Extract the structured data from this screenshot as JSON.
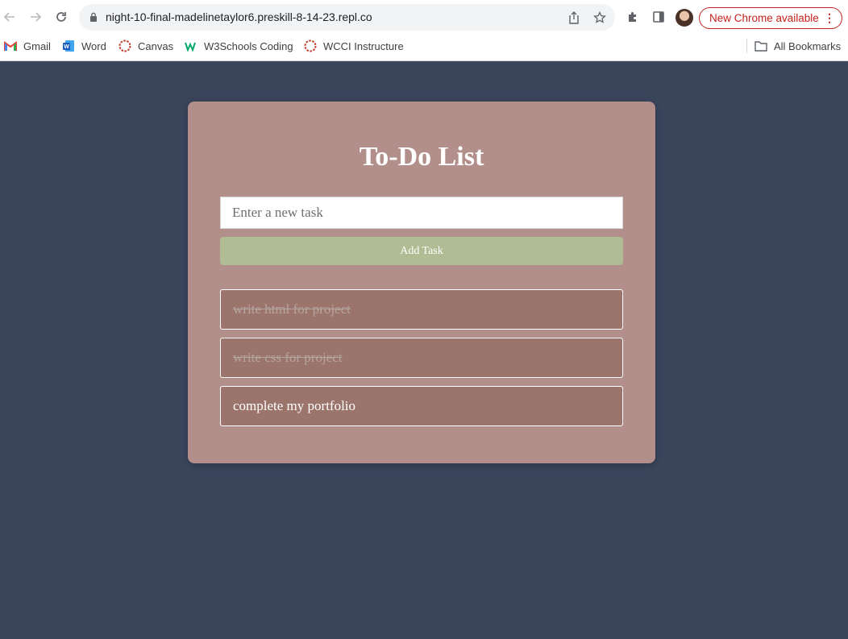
{
  "browser": {
    "url": "night-10-final-madelinetaylor6.preskill-8-14-23.repl.co",
    "update_label": "New Chrome available",
    "bookmarks": [
      {
        "label": "Gmail",
        "icon": "gmail-icon"
      },
      {
        "label": "Word",
        "icon": "word-icon"
      },
      {
        "label": "Canvas",
        "icon": "canvas-icon"
      },
      {
        "label": "W3Schools Coding",
        "icon": "w3schools-icon"
      },
      {
        "label": "WCCI Instructure",
        "icon": "instructure-icon"
      }
    ],
    "all_bookmarks_label": "All Bookmarks"
  },
  "app": {
    "title": "To-Do List",
    "input_placeholder": "Enter a new task",
    "add_button_label": "Add Task",
    "tasks": [
      {
        "text": "write html for project",
        "completed": true
      },
      {
        "text": "write css for project",
        "completed": true
      },
      {
        "text": "complete my portfolio",
        "completed": false
      }
    ]
  },
  "colors": {
    "page_background": "#3a455c",
    "card_background": "#b28f8b",
    "task_background": "#9b756b",
    "button_background": "#b0bc94",
    "update_accent": "#c5221f"
  }
}
